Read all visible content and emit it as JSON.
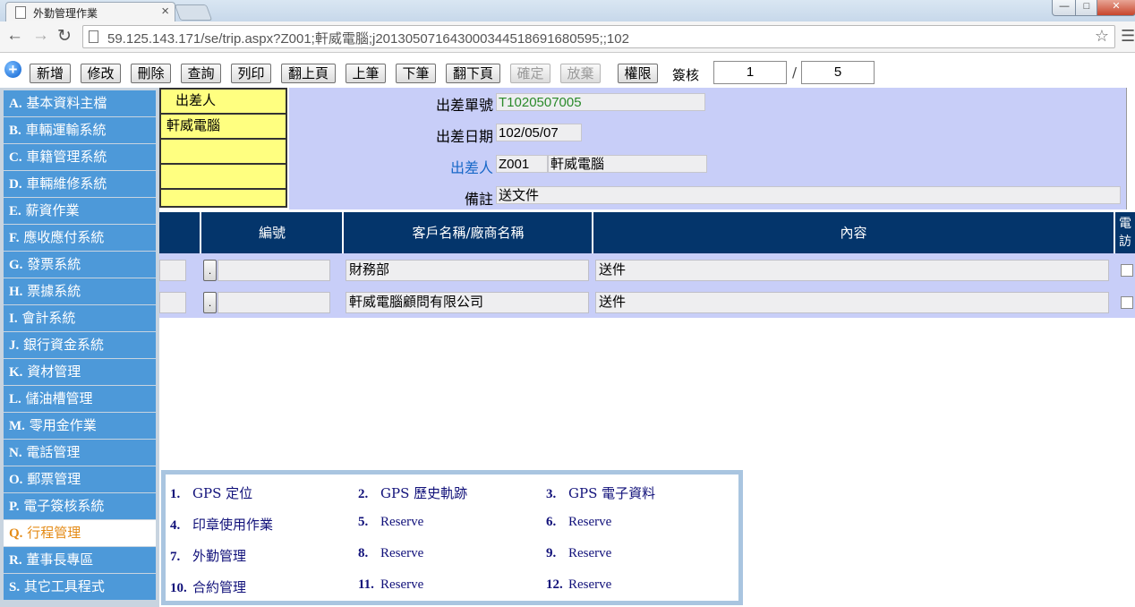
{
  "browser": {
    "tab_title": "外勤管理作業",
    "tab_close": "×",
    "url": "59.125.143.171/se/trip.aspx?Z001;軒威電腦;j20130507164300034451869168059​5;;102",
    "win_min": "—",
    "win_max": "□",
    "win_close": "✕"
  },
  "toolbar": {
    "add_icon": "plus-icon",
    "buttons": [
      "新增",
      "修改",
      "刪除",
      "查詢",
      "列印",
      "翻上頁",
      "上筆",
      "下筆",
      "翻下頁",
      "確定",
      "放棄",
      "權限"
    ],
    "disabled": [
      "確定",
      "放棄"
    ],
    "sign_label": "簽核",
    "page_current": "1",
    "page_sep": "/",
    "page_total": "5"
  },
  "menu": {
    "items": [
      {
        "key": "A.",
        "label": "基本資料主檔"
      },
      {
        "key": "B.",
        "label": "車輛運輸系統"
      },
      {
        "key": "C.",
        "label": "車籍管理系統"
      },
      {
        "key": "D.",
        "label": "車輛維修系統"
      },
      {
        "key": "E.",
        "label": "薪資作業"
      },
      {
        "key": "F.",
        "label": "應收應付系統"
      },
      {
        "key": "G.",
        "label": "發票系統"
      },
      {
        "key": "H.",
        "label": "票據系統"
      },
      {
        "key": "I.",
        "label": "會計系統"
      },
      {
        "key": "J.",
        "label": "銀行資金系統"
      },
      {
        "key": "K.",
        "label": "資材管理"
      },
      {
        "key": "L.",
        "label": "儲油槽管理"
      },
      {
        "key": "M.",
        "label": "零用金作業"
      },
      {
        "key": "N.",
        "label": "電話管理"
      },
      {
        "key": "O.",
        "label": "郵票管理"
      },
      {
        "key": "P.",
        "label": "電子簽核系統"
      },
      {
        "key": "Q.",
        "label": "行程管理"
      },
      {
        "key": "R.",
        "label": "董事長專區"
      },
      {
        "key": "S.",
        "label": "其它工具程式"
      }
    ],
    "active": "Q."
  },
  "list": {
    "header": "出差人",
    "rows": [
      "軒威電腦",
      "",
      "",
      ""
    ]
  },
  "form": {
    "trip_no_label": "出差單號",
    "trip_no": "T1020507005",
    "trip_date_label": "出差日期",
    "trip_date": "102/05/07",
    "traveler_label": "出差人",
    "traveler_code": "Z001",
    "traveler_name": "軒威電腦",
    "note_label": "備註",
    "note": "送文件"
  },
  "grid": {
    "columns": [
      "編號",
      "客戶名稱/廠商名稱",
      "內容",
      "電訪"
    ],
    "rows": [
      {
        "dot": ".",
        "number": "",
        "customer": "財務部",
        "content": "送件"
      },
      {
        "dot": ".",
        "number": "",
        "customer": "軒威電腦顧問有限公司",
        "content": "送件"
      }
    ]
  },
  "panel": {
    "items": [
      {
        "num": "1.",
        "label": "GPS 定位"
      },
      {
        "num": "2.",
        "label": "GPS 歷史軌跡"
      },
      {
        "num": "3.",
        "label": "GPS 電子資料"
      },
      {
        "num": "4.",
        "label": "印章使用作業"
      },
      {
        "num": "5.",
        "label": "Reserve"
      },
      {
        "num": "6.",
        "label": "Reserve"
      },
      {
        "num": "7.",
        "label": "外勤管理"
      },
      {
        "num": "8.",
        "label": "Reserve"
      },
      {
        "num": "9.",
        "label": "Reserve"
      },
      {
        "num": "10.",
        "label": "合約管理"
      },
      {
        "num": "11.",
        "label": "Reserve"
      },
      {
        "num": "12.",
        "label": "Reserve"
      }
    ]
  }
}
